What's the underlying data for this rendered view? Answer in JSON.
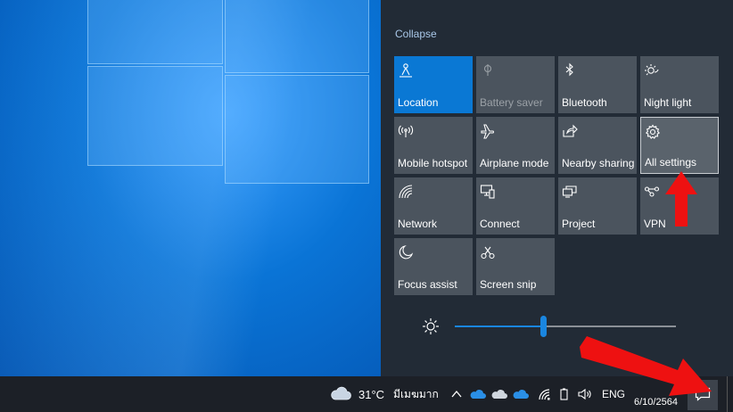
{
  "action_center": {
    "collapse_label": "Collapse",
    "tiles": [
      {
        "label": "Location",
        "icon": "location-icon",
        "state": "active"
      },
      {
        "label": "Battery saver",
        "icon": "battery-saver-icon",
        "state": "disabled"
      },
      {
        "label": "Bluetooth",
        "icon": "bluetooth-icon",
        "state": "normal"
      },
      {
        "label": "Night light",
        "icon": "night-light-icon",
        "state": "normal"
      },
      {
        "label": "Mobile hotspot",
        "icon": "mobile-hotspot-icon",
        "state": "normal"
      },
      {
        "label": "Airplane mode",
        "icon": "airplane-icon",
        "state": "normal"
      },
      {
        "label": "Nearby sharing",
        "icon": "nearby-sharing-icon",
        "state": "normal"
      },
      {
        "label": "All settings",
        "icon": "gear-icon",
        "state": "hover"
      },
      {
        "label": "Network",
        "icon": "network-icon",
        "state": "normal"
      },
      {
        "label": "Connect",
        "icon": "connect-icon",
        "state": "normal"
      },
      {
        "label": "Project",
        "icon": "project-icon",
        "state": "normal"
      },
      {
        "label": "VPN",
        "icon": "vpn-icon",
        "state": "normal"
      },
      {
        "label": "Focus assist",
        "icon": "moon-icon",
        "state": "normal"
      },
      {
        "label": "Screen snip",
        "icon": "screen-snip-icon",
        "state": "normal"
      }
    ],
    "brightness": {
      "level_fraction": 0.4,
      "icon": "sun-icon"
    }
  },
  "taskbar": {
    "weather_temp": "31°C",
    "weather_desc": "มีเมฆมาก",
    "weather_icon": "cloud-icon",
    "language": "ENG",
    "date": "6/10/2564",
    "tray_icons": [
      "chevron-up-icon",
      "onedrive-icon",
      "onedrive-gray-icon",
      "onedrive-icon",
      "wifi-icon",
      "volume-icon"
    ],
    "notification_icon": "notification-icon"
  },
  "colors": {
    "accent": "#0a78d4",
    "panel": "#222b36",
    "tile": "#4b545e",
    "taskbar": "#1c2027",
    "arrow": "#ee1111"
  }
}
